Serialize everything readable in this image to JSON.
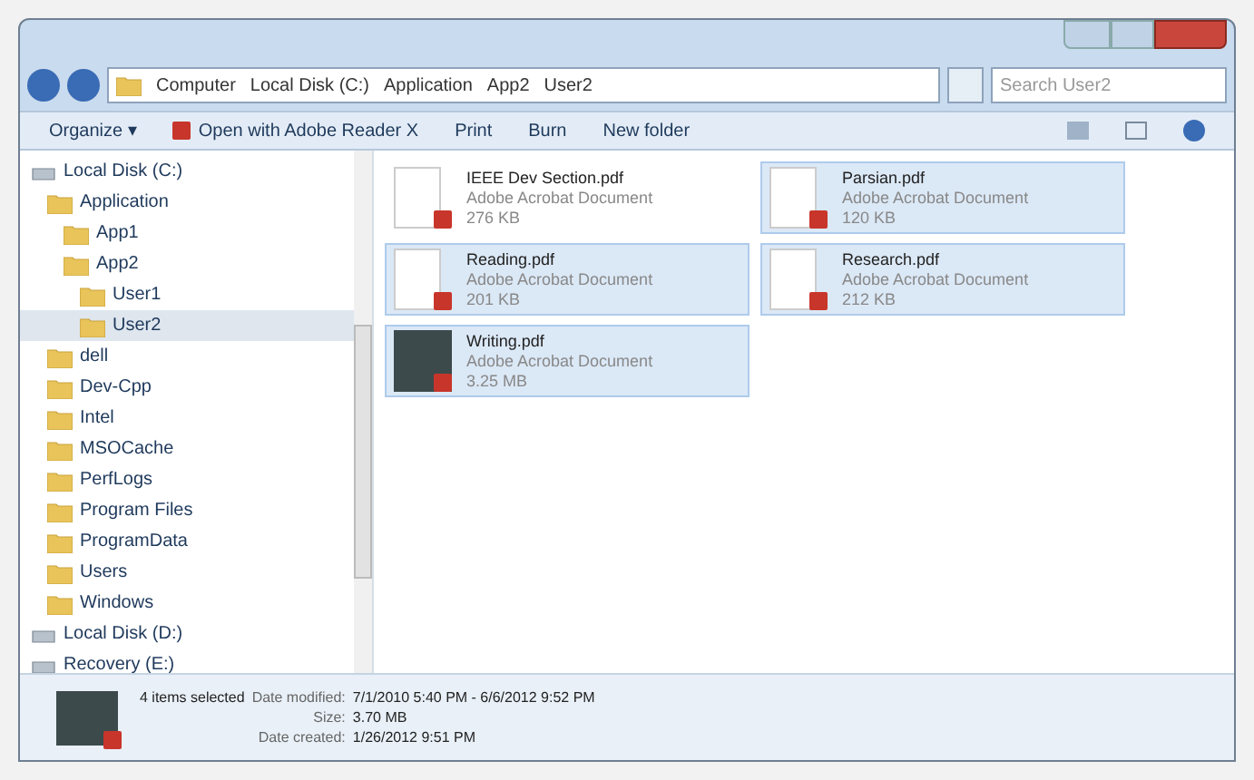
{
  "breadcrumb": [
    "Computer",
    "Local Disk (C:)",
    "Application",
    "App2",
    "User2"
  ],
  "search": {
    "placeholder": "Search User2"
  },
  "toolbar": [
    {
      "label": "Organize ▾",
      "kind": "menu"
    },
    {
      "label": "Open with Adobe Reader X",
      "kind": "pdf"
    },
    {
      "label": "Print",
      "kind": "plain"
    },
    {
      "label": "Burn",
      "kind": "plain"
    },
    {
      "label": "New folder",
      "kind": "plain"
    }
  ],
  "tree": [
    {
      "label": "Local Disk (C:)",
      "kind": "drive",
      "selected": false,
      "children": [
        {
          "label": "Application",
          "kind": "folder",
          "selected": false,
          "children": [
            {
              "label": "App1",
              "kind": "folder",
              "selected": false
            },
            {
              "label": "App2",
              "kind": "folder",
              "selected": false,
              "children": [
                {
                  "label": "User1",
                  "kind": "folder",
                  "selected": false
                },
                {
                  "label": "User2",
                  "kind": "folder",
                  "selected": true
                }
              ]
            }
          ]
        },
        {
          "label": "dell",
          "kind": "folder",
          "selected": false
        },
        {
          "label": "Dev-Cpp",
          "kind": "folder",
          "selected": false
        },
        {
          "label": "Intel",
          "kind": "folder",
          "selected": false
        },
        {
          "label": "MSOCache",
          "kind": "folder",
          "selected": false
        },
        {
          "label": "PerfLogs",
          "kind": "folder",
          "selected": false
        },
        {
          "label": "Program Files",
          "kind": "folder",
          "selected": false
        },
        {
          "label": "ProgramData",
          "kind": "folder",
          "selected": false
        },
        {
          "label": "Users",
          "kind": "folder",
          "selected": false
        },
        {
          "label": "Windows",
          "kind": "folder",
          "selected": false
        }
      ]
    },
    {
      "label": "Local Disk (D:)",
      "kind": "drive",
      "selected": false
    },
    {
      "label": "Recovery (E:)",
      "kind": "drive",
      "selected": false
    }
  ],
  "files": [
    {
      "name": "IEEE Dev Section.pdf",
      "type": "Adobe Acrobat Document",
      "size": "276 KB",
      "selected": false,
      "kind": "doc"
    },
    {
      "name": "Parsian.pdf",
      "type": "Adobe Acrobat Document",
      "size": "120 KB",
      "selected": true,
      "kind": "doc"
    },
    {
      "name": "Reading.pdf",
      "type": "Adobe Acrobat Document",
      "size": "201 KB",
      "selected": true,
      "kind": "doc"
    },
    {
      "name": "Research.pdf",
      "type": "Adobe Acrobat Document",
      "size": "212 KB",
      "selected": true,
      "kind": "doc"
    },
    {
      "name": "Writing.pdf",
      "type": "Adobe Acrobat Document",
      "size": "3.25 MB",
      "selected": true,
      "kind": "photo"
    }
  ],
  "details": {
    "count": "4 items selected",
    "rows": [
      {
        "label": "Date modified:",
        "value": "7/1/2010 5:40 PM - 6/6/2012 9:52 PM"
      },
      {
        "label": "Size:",
        "value": "3.70 MB"
      },
      {
        "label": "Date created:",
        "value": "1/26/2012 9:51 PM"
      }
    ]
  }
}
